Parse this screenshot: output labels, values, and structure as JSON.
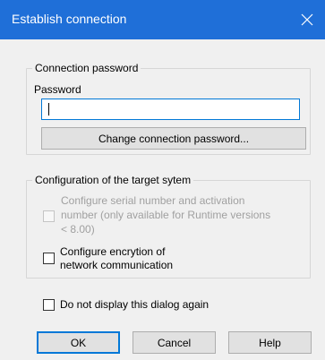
{
  "window": {
    "title": "Establish connection"
  },
  "connection_group": {
    "label": "Connection password",
    "password_label": "Password",
    "password_value": "",
    "change_button": "Change connection password..."
  },
  "config_group": {
    "label": "Configuration of the target sytem",
    "serial_option_line1": "Configure serial number and activation",
    "serial_option_line2": "number (only available for Runtime versions",
    "serial_option_line3": "< 8.00)",
    "encryption_option_line1": "Configure encrytion of",
    "encryption_option_line2": "network communication"
  },
  "dont_display": {
    "label": "Do not display this dialog again"
  },
  "buttons": {
    "ok": "OK",
    "cancel": "Cancel",
    "help": "Help"
  },
  "colors": {
    "titlebar": "#1f6fd8",
    "accent": "#0078d7"
  }
}
